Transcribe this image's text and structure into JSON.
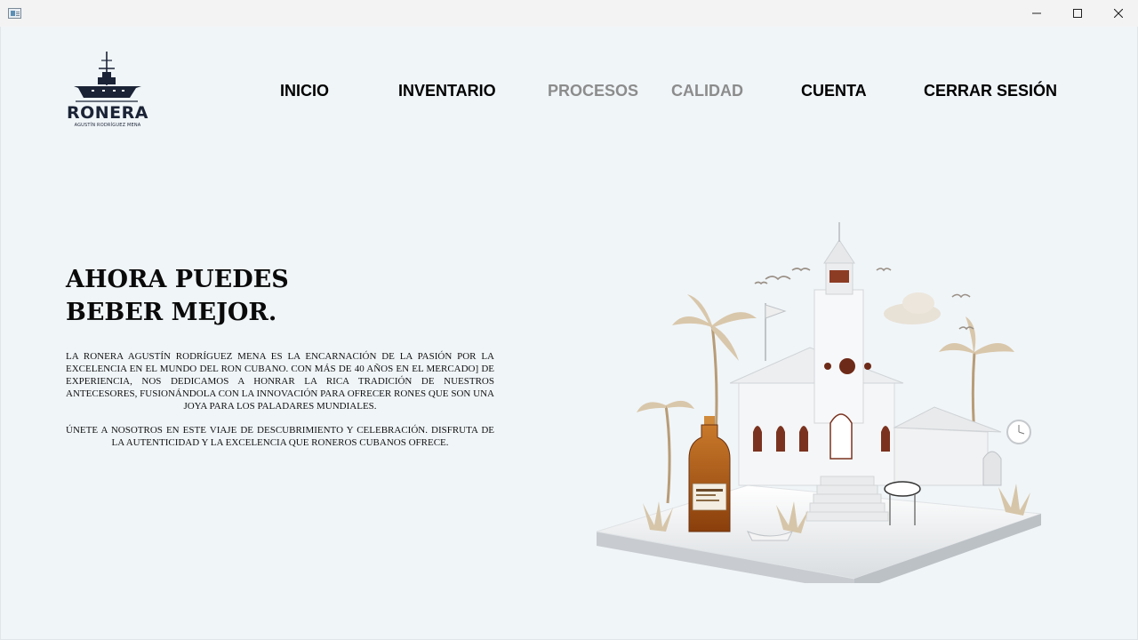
{
  "window": {
    "minimize_label": "",
    "maximize_label": "",
    "close_label": ""
  },
  "logo": {
    "name": "RONERA",
    "subtitle": "AGUSTÍN RODRÍGUEZ MENA"
  },
  "nav": {
    "items": [
      {
        "label": "INICIO",
        "state": "active"
      },
      {
        "label": "INVENTARIO",
        "state": "active"
      },
      {
        "label": "PROCESOS",
        "state": "muted"
      },
      {
        "label": "CALIDAD",
        "state": "muted"
      },
      {
        "label": "CUENTA",
        "state": "active"
      },
      {
        "label": "CERRAR SESIÓN",
        "state": "active"
      }
    ]
  },
  "hero": {
    "title": "AHORA PUEDES BEBER MEJOR.",
    "paragraph1": "LA RONERA AGUSTÍN RODRÍGUEZ MENA ES LA ENCARNACIÓN DE LA PASIÓN POR LA EXCELENCIA EN EL MUNDO DEL RON CUBANO.  CON MÁS DE 40 AÑOS EN EL MERCADO] DE EXPERIENCIA, NOS DEDICAMOS A HONRAR LA RICA TRADICIÓN DE NUESTROS ANTECESORES, FUSIONÁNDOLA CON LA INNOVACIÓN PARA OFRECER RONES QUE SON UNA JOYA PARA LOS PALADARES MUNDIALES.",
    "paragraph2": "ÚNETE A NOSOTROS EN ESTE VIAJE DE DESCUBRIMIENTO Y CELEBRACIÓN. DISFRUTA DE LA AUTENTICIDAD Y LA EXCELENCIA QUE RONEROS CUBANOS OFRECE."
  },
  "icons": {
    "app": "app-window-icon",
    "minimize": "minimize-icon",
    "maximize": "maximize-icon",
    "close": "close-icon",
    "logo": "ship-logo-icon",
    "illustration": "rum-distillery-illustration"
  },
  "colors": {
    "background": "#f0f5f8",
    "nav_active": "#000000",
    "nav_muted": "#8c8c8c",
    "logo": "#1b2336"
  }
}
